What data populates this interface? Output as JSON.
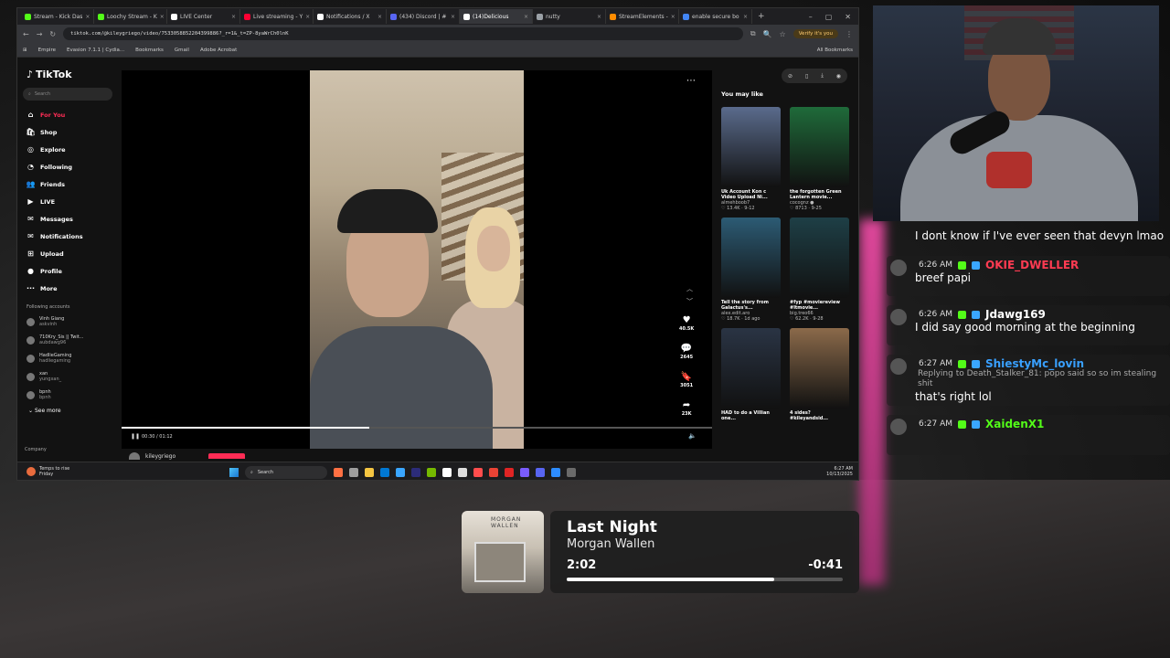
{
  "browser": {
    "tabs": [
      {
        "label": "Stream - Kick Das",
        "color": "#53fc18"
      },
      {
        "label": "Loochy Stream - K",
        "color": "#53fc18"
      },
      {
        "label": "LIVE Center",
        "color": "#ffffff"
      },
      {
        "label": "Live streaming - Y",
        "color": "#ff0033"
      },
      {
        "label": "Notifications / X",
        "color": "#ffffff"
      },
      {
        "label": "(434) Discord | #",
        "color": "#5865f2"
      },
      {
        "label": "(14)Delicious",
        "color": "#ffffff",
        "active": true
      },
      {
        "label": "nutty",
        "color": "#9aa0a6"
      },
      {
        "label": "StreamElements -",
        "color": "#ff8c00"
      },
      {
        "label": "enable secure bo",
        "color": "#4285f4"
      }
    ],
    "url": "tiktok.com/@kileygriego/video/7533058852204399886?_r=1&_t=ZP-8yaWrCh0lnK",
    "verify": "Verify it's you",
    "bookmarks": [
      "Empire",
      "Evasion 7.1.1 | Cydia...",
      "Bookmarks",
      "Gmail",
      "Adobe Acrobat"
    ],
    "all_bookmarks": "All Bookmarks"
  },
  "tiktok": {
    "logo": "TikTok",
    "search_placeholder": "Search",
    "menu": [
      {
        "label": "For You",
        "icon": "⌂",
        "active": true
      },
      {
        "label": "Shop",
        "icon": "🛍"
      },
      {
        "label": "Explore",
        "icon": "◎"
      },
      {
        "label": "Following",
        "icon": "◔"
      },
      {
        "label": "Friends",
        "icon": "👥"
      },
      {
        "label": "LIVE",
        "icon": "▶"
      },
      {
        "label": "Messages",
        "icon": "✉"
      },
      {
        "label": "Notifications",
        "icon": "✉"
      },
      {
        "label": "Upload",
        "icon": "⊞"
      },
      {
        "label": "Profile",
        "icon": "●"
      },
      {
        "label": "More",
        "icon": "···"
      }
    ],
    "following_title": "Following accounts",
    "following": [
      {
        "name": "Vinh Giang",
        "handle": "askvinh"
      },
      {
        "name": "710Kry_Sis || Twit...",
        "handle": "aubdawg96"
      },
      {
        "name": "HadlieGaming",
        "handle": "hadliegaming"
      },
      {
        "name": "xan",
        "handle": "yungxan_"
      },
      {
        "name": "bpnh",
        "handle": "bpnh"
      }
    ],
    "see_more": "See more",
    "company": "Company",
    "player": {
      "time": "00:30 / 01:12",
      "progress": 0.42,
      "author": "kileygriego",
      "actions": [
        {
          "icon": "♥",
          "count": "40.5K"
        },
        {
          "icon": "💬",
          "count": "2645"
        },
        {
          "icon": "🔖",
          "count": "3051"
        },
        {
          "icon": "➦",
          "count": "23K"
        }
      ]
    },
    "ymal": {
      "title": "You may like",
      "cards": [
        {
          "caption": "Uk Account Kon c Video Upload Ni...",
          "user": "almehboob7",
          "stats": "♡ 13.4K · 9-12",
          "color": "#5a6b8c"
        },
        {
          "caption": "the forgotten Green Lantern movie...",
          "user": "cocognz ●",
          "stats": "♡ 8713 · 9-25",
          "color": "#1f6b3a"
        },
        {
          "caption": "Tell the story from Galactus's...",
          "user": "alex.edit.aro",
          "stats": "♡ 18.7K · 1d ago",
          "color": "#2c5b74"
        },
        {
          "caption": "#fyp #moviereview #ltmovie...",
          "user": "big.treo66",
          "stats": "♡ 62.2K · 9-28",
          "color": "#1e3f46"
        },
        {
          "caption": "HAD to do a Villian one...",
          "user": "",
          "stats": "",
          "color": "#2a3444"
        },
        {
          "caption": "4 sides? #kileyandsid...",
          "user": "",
          "stats": "",
          "color": "#8b6a4a"
        }
      ]
    }
  },
  "taskbar": {
    "weather_title": "Temps to rise",
    "weather_day": "Friday",
    "search": "Search",
    "time": "6:27 AM",
    "date": "10/13/2025",
    "apps": [
      "#ff7043",
      "#9e9e9e",
      "#f4c542",
      "#0078d4",
      "#3aa6ff",
      "#2c2c7a",
      "#76b900",
      "#ffffff",
      "#dddddd",
      "#ff4d4d",
      "#ea4335",
      "#e02424",
      "#7a5cff",
      "#5865f2",
      "#2d8cff",
      "#6a6a6a"
    ]
  },
  "chat": [
    {
      "time": "",
      "user": "",
      "user_color": "#ffffff",
      "text": "I dont know if I've ever seen that devyn lmao",
      "reply": ""
    },
    {
      "time": "6:26 AM",
      "user": "OKIE_DWELLER",
      "user_color": "#ff3b52",
      "text": "breef papi",
      "reply": ""
    },
    {
      "time": "6:26 AM",
      "user": "Jdawg169",
      "user_color": "#ffffff",
      "text": "I did say good morning at the beginning",
      "reply": ""
    },
    {
      "time": "6:27 AM",
      "user": "ShiestyMc_lovin",
      "user_color": "#39a0ff",
      "text": "that's right lol",
      "reply": "Replying to Death_Stalker_81: popo said so so im stealing shit"
    },
    {
      "time": "6:27 AM",
      "user": "XaidenX1",
      "user_color": "#53fc18",
      "text": "",
      "reply": ""
    }
  ],
  "now_playing": {
    "title": "Last Night",
    "artist": "Morgan Wallen",
    "current": "2:02",
    "remaining": "-0:41",
    "progress": 0.75,
    "art_text": "MORGAN WALLEN"
  }
}
